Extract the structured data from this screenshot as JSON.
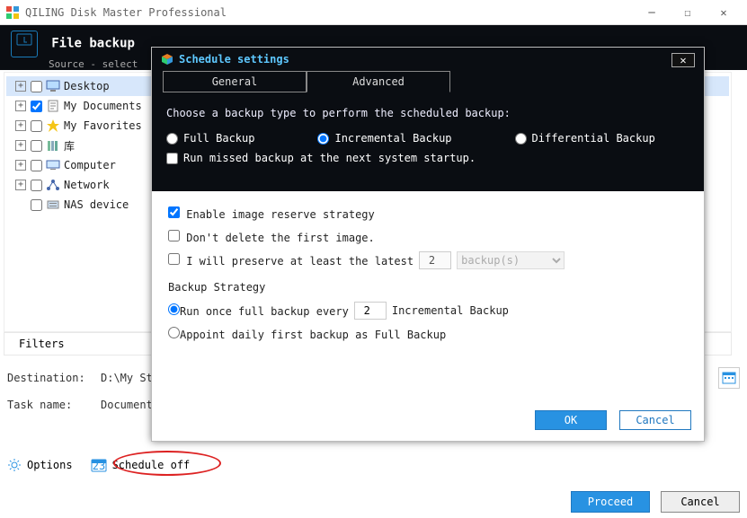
{
  "app": {
    "title": "QILING Disk Master Professional"
  },
  "header": {
    "title": "File backup",
    "sub": "Source - select"
  },
  "tree": {
    "items": [
      {
        "label": "Desktop",
        "checked": false,
        "selected": true,
        "expandable": true,
        "icon": "desktop"
      },
      {
        "label": "My Documents",
        "checked": true,
        "selected": false,
        "expandable": true,
        "icon": "docs"
      },
      {
        "label": "My Favorites",
        "checked": false,
        "selected": false,
        "expandable": true,
        "icon": "star"
      },
      {
        "label": "库",
        "checked": false,
        "selected": false,
        "expandable": true,
        "icon": "lib"
      },
      {
        "label": "Computer",
        "checked": false,
        "selected": false,
        "expandable": true,
        "icon": "computer"
      },
      {
        "label": "Network",
        "checked": false,
        "selected": false,
        "expandable": true,
        "icon": "network"
      },
      {
        "label": "NAS device",
        "checked": false,
        "selected": false,
        "expandable": false,
        "icon": "nas"
      }
    ]
  },
  "filters_label": "Filters",
  "dest": {
    "label": "Destination:",
    "value": "D:\\My St"
  },
  "task": {
    "label": "Task name:",
    "value": "Documents"
  },
  "bottom": {
    "options": "Options",
    "schedule": "Schedule off",
    "proceed": "Proceed",
    "cancel": "Cancel"
  },
  "modal": {
    "title": "Schedule settings",
    "tabs": {
      "general": "General",
      "advanced": "Advanced",
      "active": "advanced"
    },
    "hint": "Choose a backup type to perform the scheduled backup:",
    "backup_types": {
      "full": "Full Backup",
      "incremental": "Incremental Backup",
      "differential": "Differential Backup",
      "selected": "incremental"
    },
    "run_missed": {
      "label": "Run missed backup at the next system startup.",
      "checked": false
    },
    "reserve": {
      "enable": {
        "label": "Enable image reserve strategy",
        "checked": true
      },
      "dont_delete": {
        "label": "Don't delete the first image.",
        "checked": false
      },
      "preserve": {
        "label": "I will preserve at least the latest",
        "checked": false,
        "num": 2,
        "unit": "backup(s)"
      }
    },
    "strategy": {
      "heading": "Backup Strategy",
      "opt1": {
        "pre": "Run once full backup every",
        "num": 2,
        "post": "Incremental Backup"
      },
      "opt2": "Appoint daily first backup as Full Backup",
      "selected": "opt1"
    },
    "buttons": {
      "ok": "OK",
      "cancel": "Cancel"
    }
  }
}
